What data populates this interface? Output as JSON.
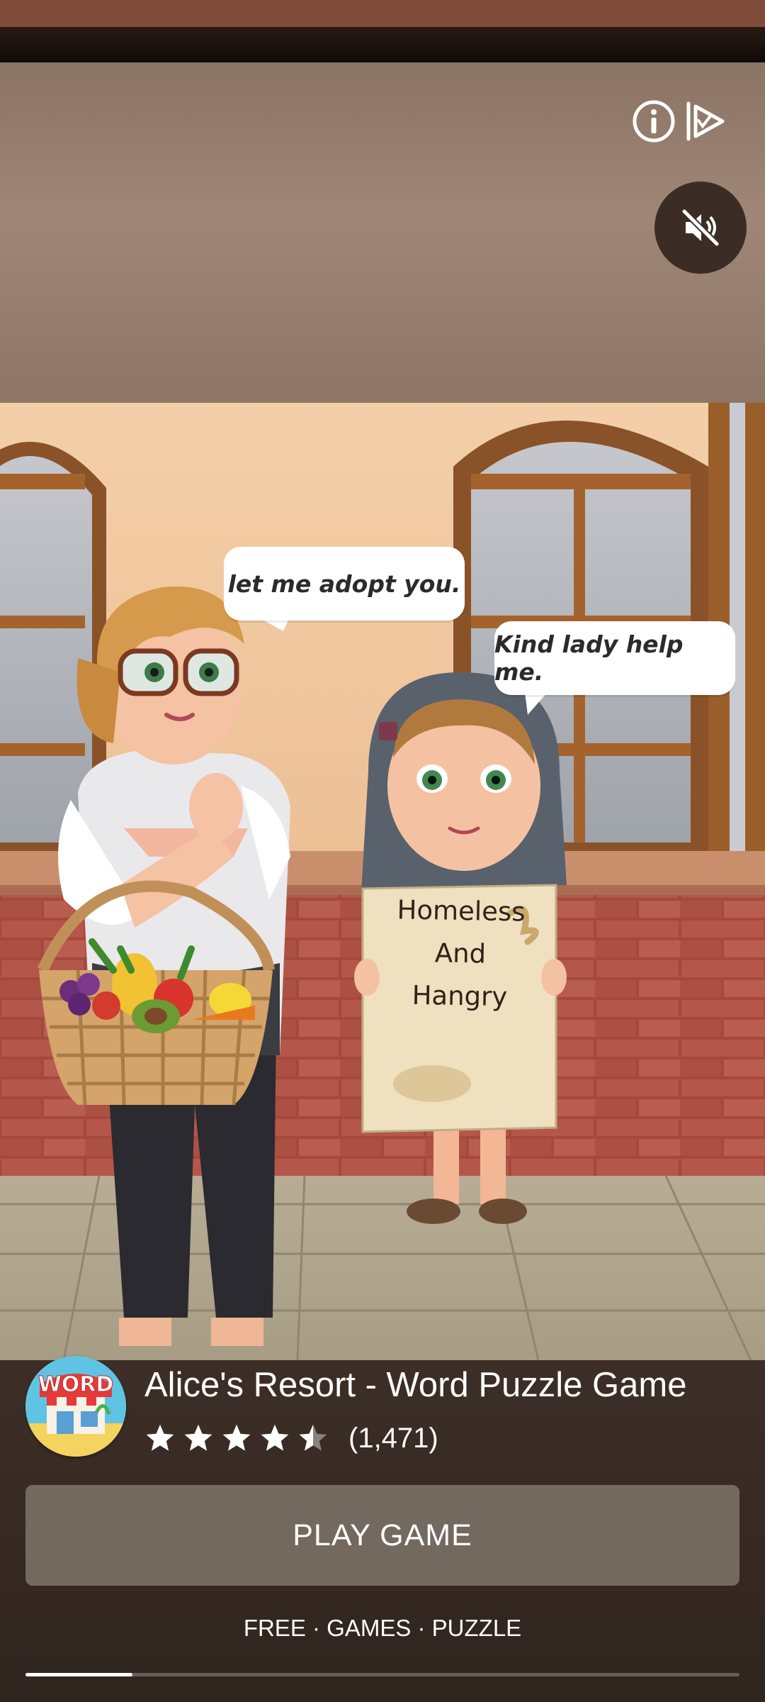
{
  "ad": {
    "info_icon": "info-icon",
    "adchoices_icon": "adchoices-icon",
    "mute_icon": "volume-muted-icon"
  },
  "scene": {
    "bubble_left": "let me adopt you.",
    "bubble_right": "Kind lady help me.",
    "sign_text": "Homeless\nAnd\nHangry"
  },
  "app": {
    "title": "Alice's Resort - Word Puzzle Game",
    "icon_text": "WORD",
    "rating": 4.5,
    "rating_count": "(1,471)",
    "play_label": "PLAY GAME",
    "categories": "FREE · GAMES · PUZZLE"
  },
  "progress": {
    "fraction": 0.15
  },
  "colors": {
    "panel": "#3d2f27",
    "button": "#74695f",
    "star": "#ffffff",
    "star_empty": "#8c8179"
  }
}
